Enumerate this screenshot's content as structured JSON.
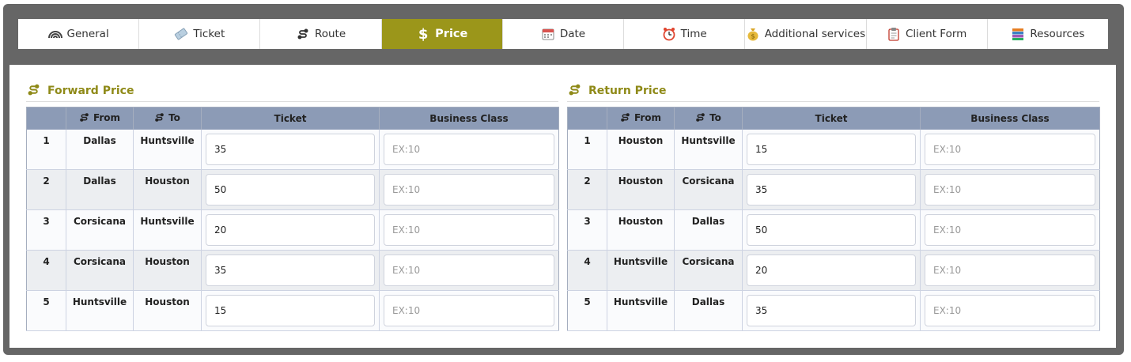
{
  "tabs": [
    {
      "label": "General",
      "icon": "rainbow-icon"
    },
    {
      "label": "Ticket",
      "icon": "ticket-icon"
    },
    {
      "label": "Route",
      "icon": "route-icon"
    },
    {
      "label": "Price",
      "icon": "dollar-icon",
      "active": true
    },
    {
      "label": "Date",
      "icon": "calendar-icon"
    },
    {
      "label": "Time",
      "icon": "alarm-clock-icon"
    },
    {
      "label": "Additional services",
      "icon": "money-bag-icon"
    },
    {
      "label": "Client Form",
      "icon": "clipboard-icon"
    },
    {
      "label": "Resources",
      "icon": "books-icon"
    }
  ],
  "colors": {
    "accent": "#9b961a",
    "title": "#8f8a18",
    "header_bg": "#8c9bb6"
  },
  "forward": {
    "title": "Forward Price",
    "headers": {
      "num": "",
      "from": "From",
      "to": "To",
      "ticket": "Ticket",
      "business": "Business Class"
    },
    "rows": [
      {
        "n": "1",
        "from": "Dallas",
        "to": "Huntsville",
        "ticket": "35",
        "business": ""
      },
      {
        "n": "2",
        "from": "Dallas",
        "to": "Houston",
        "ticket": "50",
        "business": ""
      },
      {
        "n": "3",
        "from": "Corsicana",
        "to": "Huntsville",
        "ticket": "20",
        "business": ""
      },
      {
        "n": "4",
        "from": "Corsicana",
        "to": "Houston",
        "ticket": "35",
        "business": ""
      },
      {
        "n": "5",
        "from": "Huntsville",
        "to": "Houston",
        "ticket": "15",
        "business": ""
      }
    ],
    "business_placeholder": "EX:10"
  },
  "return": {
    "title": "Return Price",
    "headers": {
      "num": "",
      "from": "From",
      "to": "To",
      "ticket": "Ticket",
      "business": "Business Class"
    },
    "rows": [
      {
        "n": "1",
        "from": "Houston",
        "to": "Huntsville",
        "ticket": "15",
        "business": ""
      },
      {
        "n": "2",
        "from": "Houston",
        "to": "Corsicana",
        "ticket": "35",
        "business": ""
      },
      {
        "n": "3",
        "from": "Houston",
        "to": "Dallas",
        "ticket": "50",
        "business": ""
      },
      {
        "n": "4",
        "from": "Huntsville",
        "to": "Corsicana",
        "ticket": "20",
        "business": ""
      },
      {
        "n": "5",
        "from": "Huntsville",
        "to": "Dallas",
        "ticket": "35",
        "business": ""
      }
    ],
    "business_placeholder": "EX:10"
  }
}
